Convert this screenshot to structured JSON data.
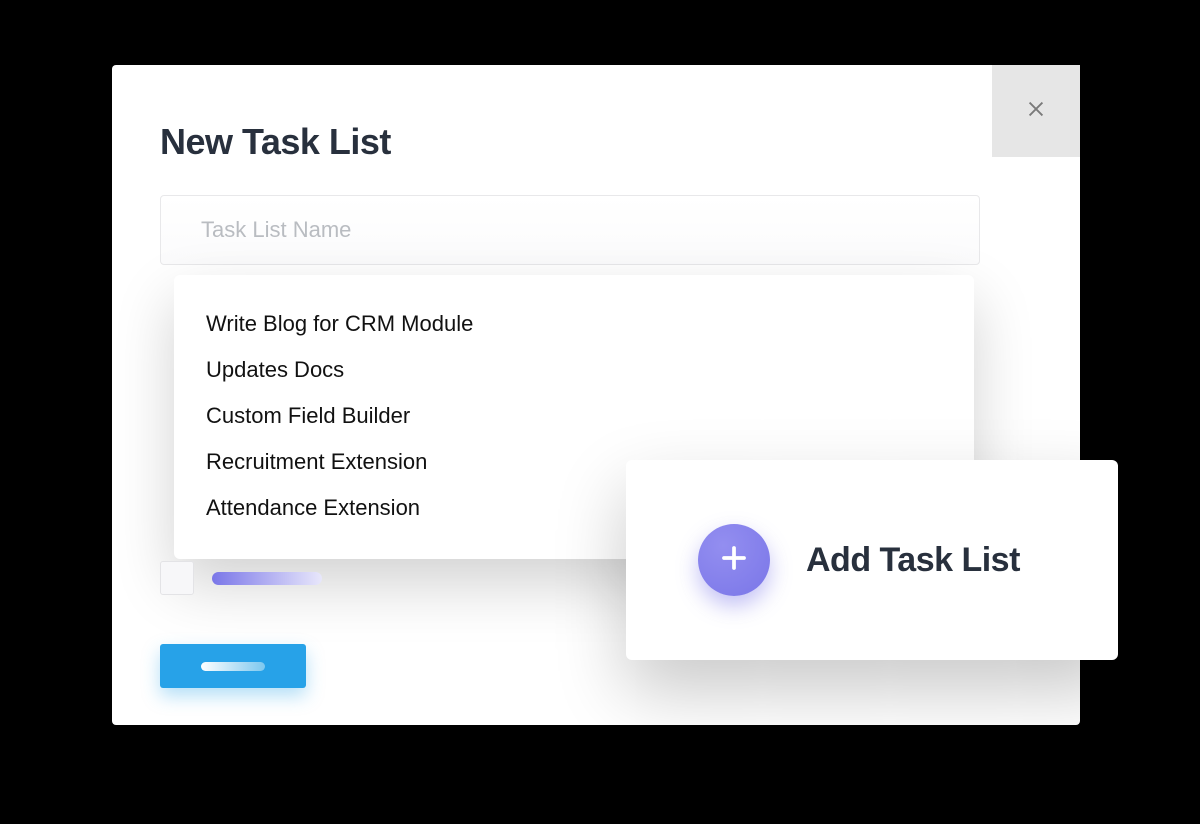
{
  "modal": {
    "title": "New Task List",
    "input": {
      "placeholder": "Task List Name",
      "value": ""
    },
    "suggestions": [
      "Write Blog for CRM Module",
      "Updates Docs",
      "Custom Field Builder",
      "Recruitment Extension",
      "Attendance Extension"
    ],
    "close_icon": "close-icon"
  },
  "add_card": {
    "label": "Add Task List",
    "icon": "plus-icon"
  },
  "colors": {
    "accent_purple": "#7a76e8",
    "accent_blue": "#27a2e8",
    "text_dark": "#28303d",
    "placeholder": "#b9bcc1"
  }
}
